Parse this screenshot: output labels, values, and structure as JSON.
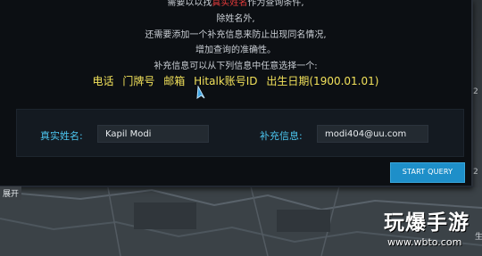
{
  "intro": {
    "line0_before": "需要以以找",
    "line0_highlight": "真实姓名",
    "line0_after": "作为查询条件,",
    "line1": "除姓名外,",
    "line2": "还需要添加一个补充信息来防止出现同名情况,",
    "line3": "增加查询的准确性。",
    "line4": "补充信息可以从下列信息中任意选择一个:"
  },
  "options": [
    "电话",
    "门牌号",
    "邮箱",
    "Hitalk账号ID",
    "出生日期(1900.01.01)"
  ],
  "form": {
    "name_label": "真实姓名:",
    "name_value": "Kapil Modi",
    "extra_label": "补充信息:",
    "extra_value": "modi404@uu.com"
  },
  "start_button": "START QUERY",
  "expand_label": "展开",
  "watermark": {
    "text": "玩爆手游",
    "url": "www.wbto.com"
  },
  "edge_chars": [
    "2",
    "2",
    "生"
  ],
  "colors": {
    "accent_label": "#4cc6f0",
    "option_text": "#f1e05a",
    "highlight": "#e23b3b",
    "button": "#1e8fc9"
  }
}
